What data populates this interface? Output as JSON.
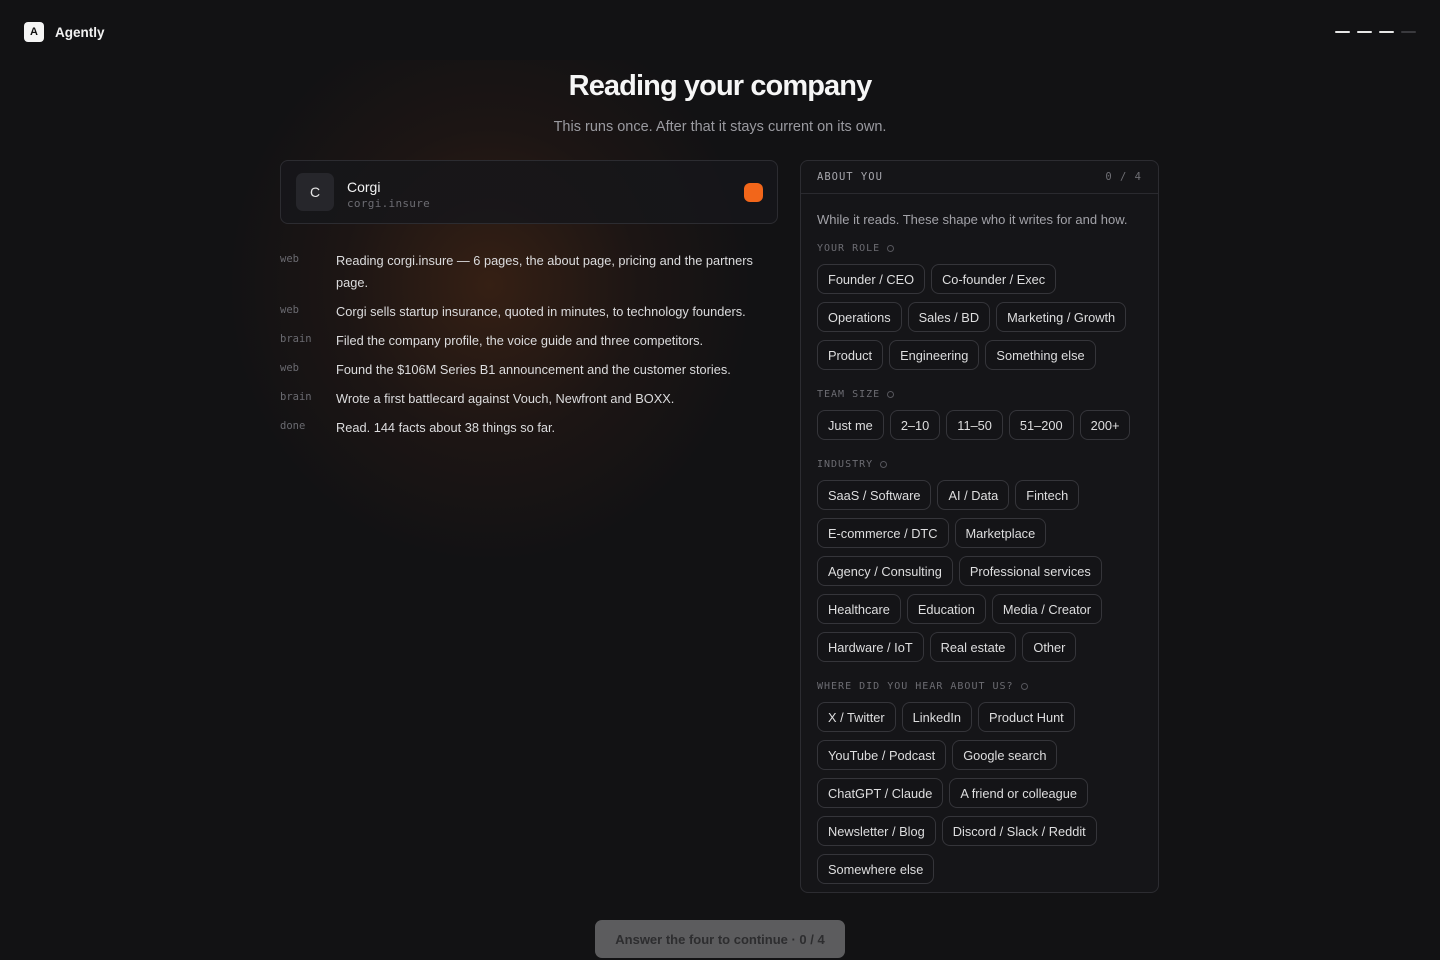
{
  "app": {
    "logo_letter": "A",
    "name": "Agently"
  },
  "progress": {
    "total_steps": 4,
    "current_step": 3
  },
  "header": {
    "title": "Reading your company",
    "subtitle": "This runs once. After that it stays current on its own."
  },
  "company": {
    "initial": "C",
    "name": "Corgi",
    "domain": "corgi.insure",
    "status_color": "#f2661a"
  },
  "log": [
    {
      "tag": "web",
      "text": "Reading corgi.insure — 6 pages, the about page, pricing and the partners page."
    },
    {
      "tag": "web",
      "text": "Corgi sells startup insurance, quoted in minutes, to technology founders."
    },
    {
      "tag": "brain",
      "text": "Filed the company profile, the voice guide and three competitors."
    },
    {
      "tag": "web",
      "text": "Found the $106M Series B1 announcement and the customer stories."
    },
    {
      "tag": "brain",
      "text": "Wrote a first battlecard against Vouch, Newfront and BOXX."
    },
    {
      "tag": "done",
      "text": "Read. 144 facts about 38 things so far."
    }
  ],
  "about": {
    "heading": "ABOUT YOU",
    "count": "0 / 4",
    "intro": "While it reads. These shape who it writes for and how.",
    "sections": [
      {
        "label": "YOUR ROLE",
        "options": [
          "Founder / CEO",
          "Co-founder / Exec",
          "Operations",
          "Sales / BD",
          "Marketing / Growth",
          "Product",
          "Engineering",
          "Something else"
        ]
      },
      {
        "label": "TEAM SIZE",
        "options": [
          "Just me",
          "2–10",
          "11–50",
          "51–200",
          "200+"
        ]
      },
      {
        "label": "INDUSTRY",
        "options": [
          "SaaS / Software",
          "AI / Data",
          "Fintech",
          "E-commerce / DTC",
          "Marketplace",
          "Agency / Consulting",
          "Professional services",
          "Healthcare",
          "Education",
          "Media / Creator",
          "Hardware / IoT",
          "Real estate",
          "Other"
        ]
      },
      {
        "label": "WHERE DID YOU HEAR ABOUT US?",
        "options": [
          "X / Twitter",
          "LinkedIn",
          "Product Hunt",
          "YouTube / Podcast",
          "Google search",
          "ChatGPT / Claude",
          "A friend or colleague",
          "Newsletter / Blog",
          "Discord / Slack / Reddit",
          "Somewhere else"
        ]
      }
    ]
  },
  "cta": {
    "label": "Answer the four to continue · 0 / 4"
  }
}
